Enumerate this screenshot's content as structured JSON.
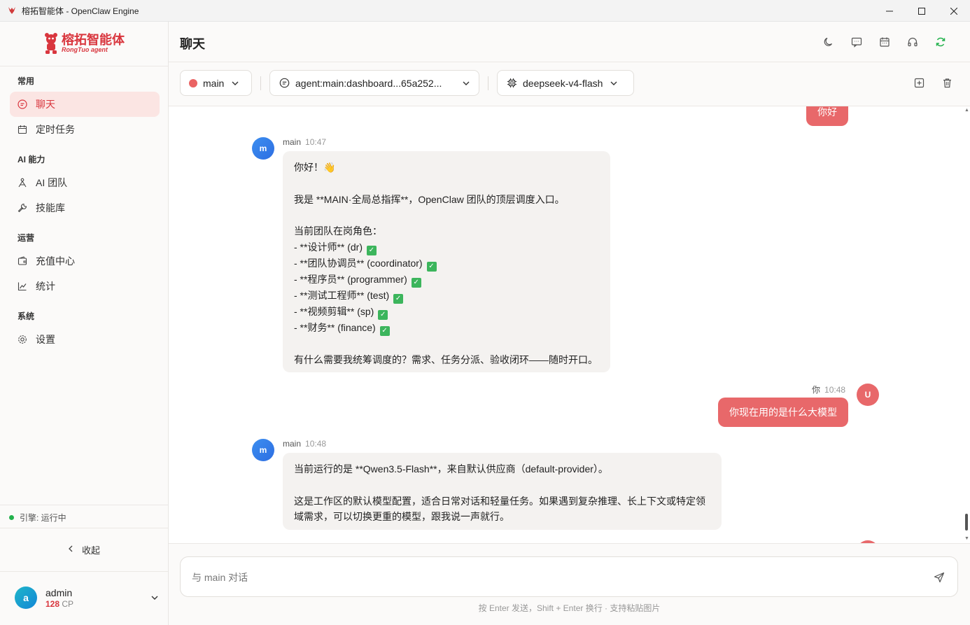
{
  "window": {
    "title": "榕拓智能体 - OpenClaw Engine"
  },
  "sidebar": {
    "logo_cn": "榕拓智能体",
    "logo_en": "RongTuo agent",
    "sections": {
      "common": "常用",
      "ai": "AI 能力",
      "ops": "运营",
      "system": "系统"
    },
    "items": {
      "chat": "聊天",
      "scheduled": "定时任务",
      "ai_team": "AI 团队",
      "skills": "技能库",
      "recharge": "充值中心",
      "stats": "统计",
      "settings": "设置"
    },
    "engine_status": "引擎: 运行中",
    "collapse": "收起",
    "user": {
      "avatar_letter": "a",
      "name": "admin",
      "cp_value": "128",
      "cp_unit": "CP"
    }
  },
  "header": {
    "title": "聊天"
  },
  "toolbar": {
    "agent": "main",
    "session": "agent:main:dashboard...65a252...",
    "model": "deepseek-v4-flash"
  },
  "messages": [
    {
      "role": "user",
      "text": "你好"
    },
    {
      "role": "bot",
      "avatar": "m",
      "name": "main",
      "time": "10:47",
      "lines": [
        "你好！👋",
        "",
        "我是 **MAIN·全局总指挥**，OpenClaw 团队的顶层调度入口。",
        "",
        "当前团队在岗角色：",
        "- **设计师** (dr)",
        "- **团队协调员** (coordinator)",
        "- **程序员** (programmer)",
        "- **测试工程师** (test)",
        "- **视频剪辑** (sp)",
        "- **财务** (finance)",
        "",
        "有什么需要我统筹调度的？需求、任务分派、验收闭环——随时开口。"
      ]
    },
    {
      "role": "user",
      "avatar": "U",
      "name": "你",
      "time": "10:48",
      "text": "你现在用的是什么大模型"
    },
    {
      "role": "bot",
      "avatar": "m",
      "name": "main",
      "time": "10:48",
      "lines": [
        "当前运行的是 **Qwen3.5-Flash**，来自默认供应商（default-provider）。",
        "",
        "这是工作区的默认模型配置，适合日常对话和轻量任务。如果遇到复杂推理、长上下文或特定领",
        "域需求，可以切换更重的模型，跟我说一声就行。"
      ]
    }
  ],
  "composer": {
    "placeholder": "与 main 对话",
    "value": "",
    "hint": "按 Enter 发送，Shift + Enter 换行 · 支持粘贴图片"
  },
  "colors": {
    "accent": "#e8686a",
    "brand_red": "#d9363e",
    "bot_avatar": "#3c8ef0",
    "status_green": "#22b14c"
  }
}
